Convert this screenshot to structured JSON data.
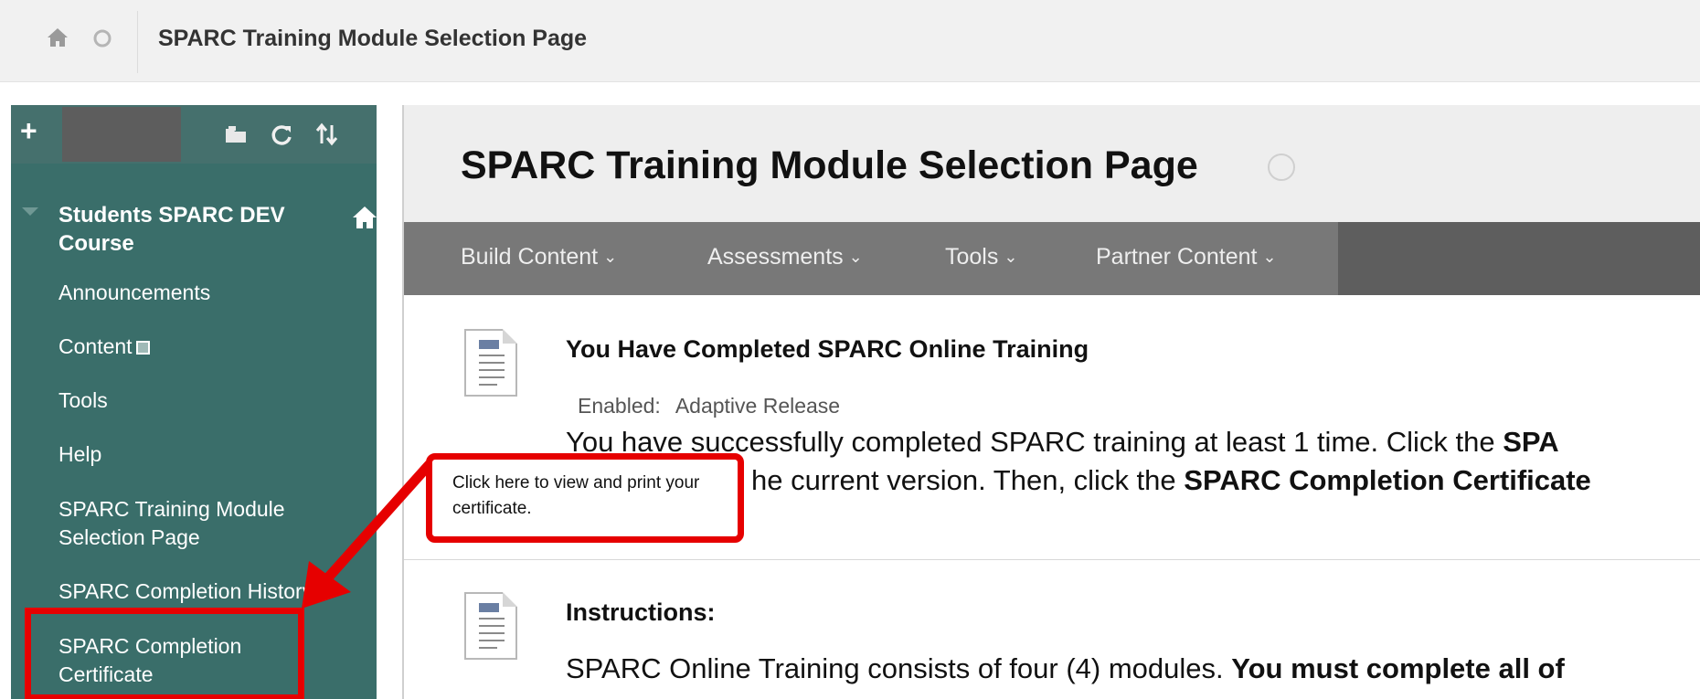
{
  "breadcrumb": {
    "title": "SPARC Training Module Selection Page",
    "icons": {
      "home": "home-icon",
      "refresh": "refresh-icon"
    }
  },
  "sidebar": {
    "toolbar_icons": [
      "plus-icon",
      "folder-icon",
      "refresh-icon",
      "sort-icon"
    ],
    "course_title": "Students SPARC DEV Course",
    "items": [
      {
        "label": "Announcements"
      },
      {
        "label": "Content"
      },
      {
        "label": "Tools"
      },
      {
        "label": "Help"
      },
      {
        "label": "SPARC Training Module Selection Page"
      },
      {
        "label": "SPARC Completion History"
      },
      {
        "label": "SPARC Completion Certificate"
      }
    ]
  },
  "page": {
    "title": "SPARC Training Module Selection Page",
    "action_bar": [
      {
        "label": "Build Content"
      },
      {
        "label": "Assessments"
      },
      {
        "label": "Tools"
      },
      {
        "label": "Partner Content"
      }
    ],
    "content_items": [
      {
        "title": "You Have Completed SPARC Online Training",
        "enabled_label": "Enabled:",
        "enabled_value": "Adaptive Release",
        "line1_prefix": "You have successfully completed SPARC training at least 1 time. Click the ",
        "line1_bold": "SPA",
        "line2_prefix": "he current version. Then, click the ",
        "line2_bold": "SPARC Completion Certificate"
      },
      {
        "title": "Instructions:",
        "line1_prefix": "SPARC Online Training consists of four (4) modules. ",
        "line1_bold": "You must complete all of"
      }
    ]
  },
  "annotation": {
    "callout_text": "Click here to view and print your certificate.",
    "highlight_color": "#e60000"
  },
  "colors": {
    "sidebar_bg": "#3a6e6a",
    "action_bar_bg": "#787878",
    "accent_red": "#e60000"
  }
}
